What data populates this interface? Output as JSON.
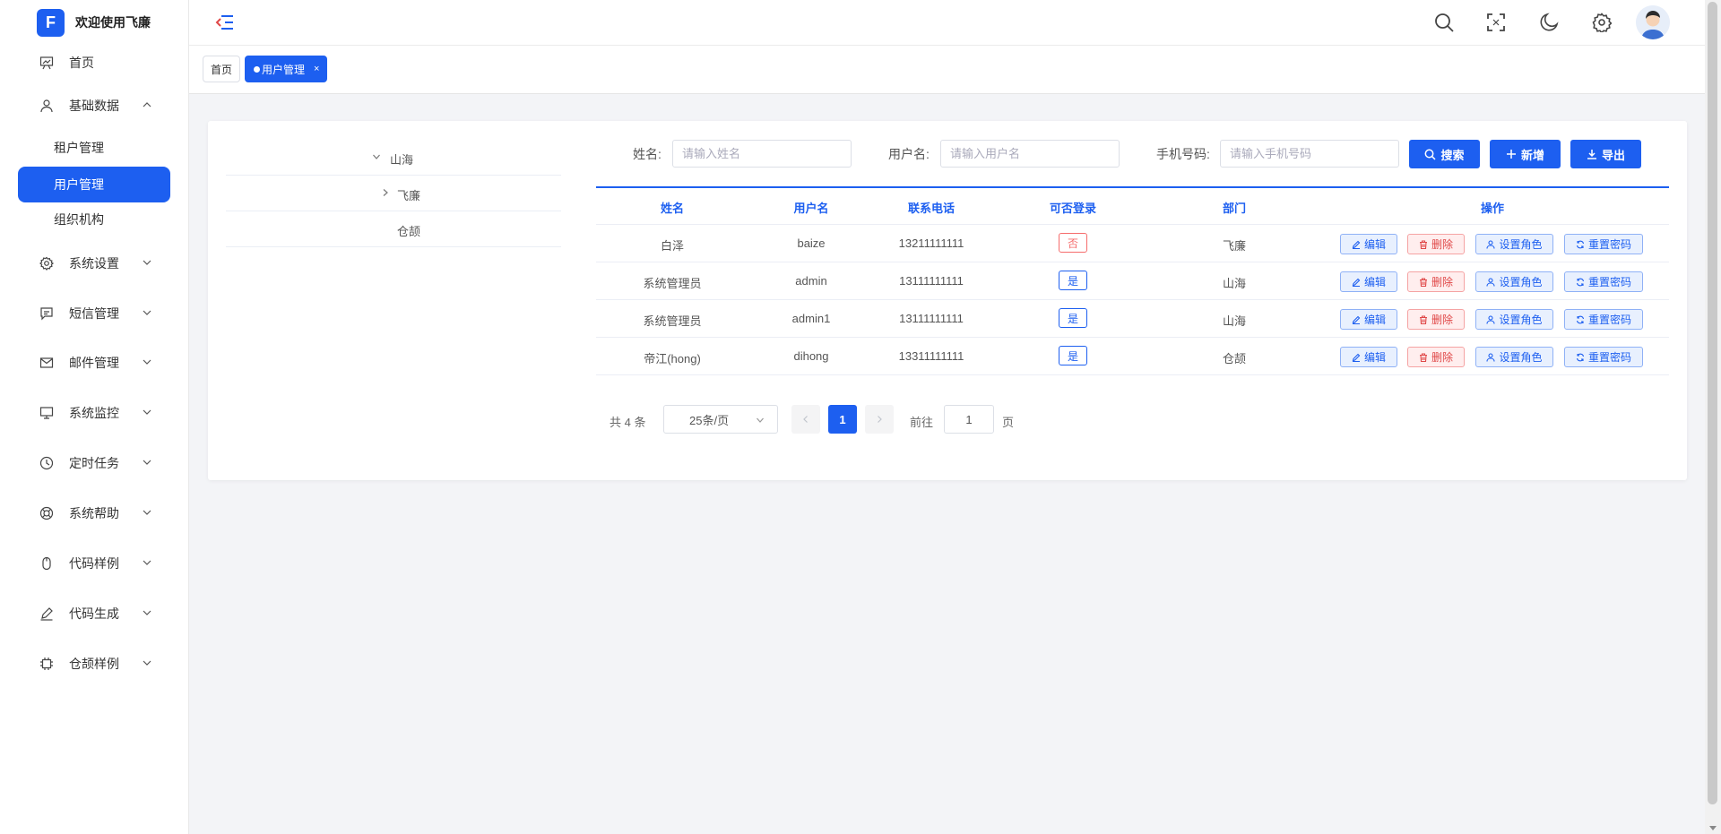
{
  "brand": {
    "logo_letter": "F",
    "title": "欢迎使用飞廉"
  },
  "sidebar": {
    "items": [
      {
        "label": "首页",
        "icon": "presentation-icon"
      },
      {
        "label": "基础数据",
        "icon": "user-icon",
        "expanded": true
      },
      {
        "label": "系统设置",
        "icon": "gear-icon"
      },
      {
        "label": "短信管理",
        "icon": "message-icon"
      },
      {
        "label": "邮件管理",
        "icon": "mail-icon"
      },
      {
        "label": "系统监控",
        "icon": "monitor-icon"
      },
      {
        "label": "定时任务",
        "icon": "clock-icon"
      },
      {
        "label": "系统帮助",
        "icon": "lifebuoy-icon"
      },
      {
        "label": "代码样例",
        "icon": "mouse-icon"
      },
      {
        "label": "代码生成",
        "icon": "pen-icon"
      },
      {
        "label": "仓颉样例",
        "icon": "chip-icon"
      }
    ],
    "subitems": [
      {
        "label": "租户管理"
      },
      {
        "label": "用户管理",
        "active": true
      },
      {
        "label": "组织机构"
      }
    ]
  },
  "tabs": [
    {
      "label": "首页"
    },
    {
      "label": "用户管理",
      "active": true,
      "close": "×"
    }
  ],
  "tree": [
    {
      "label": "山海",
      "caret": "down"
    },
    {
      "label": "飞廉",
      "caret": "right"
    },
    {
      "label": "仓颉"
    }
  ],
  "search": {
    "name_label": "姓名:",
    "name_placeholder": "请输入姓名",
    "username_label": "用户名:",
    "username_placeholder": "请输入用户名",
    "phone_label": "手机号码:",
    "phone_placeholder": "请输入手机号码",
    "search_btn": "搜索",
    "add_btn": "新增",
    "export_btn": "导出"
  },
  "table": {
    "headers": [
      "姓名",
      "用户名",
      "联系电话",
      "可否登录",
      "部门",
      "操作"
    ],
    "rows": [
      {
        "name": "白泽",
        "username": "baize",
        "phone": "13211111111",
        "login": "否",
        "dept": "飞廉"
      },
      {
        "name": "系统管理员",
        "username": "admin",
        "phone": "13111111111",
        "login": "是",
        "dept": "山海"
      },
      {
        "name": "系统管理员",
        "username": "admin1",
        "phone": "13111111111",
        "login": "是",
        "dept": "山海"
      },
      {
        "name": "帝江(hong)",
        "username": "dihong",
        "phone": "13311111111",
        "login": "是",
        "dept": "仓颉"
      }
    ],
    "actions": {
      "edit": "编辑",
      "delete": "删除",
      "role": "设置角色",
      "reset": "重置密码"
    }
  },
  "pagination": {
    "total_text": "共 4 条",
    "page_size": "25条/页",
    "current_page": "1",
    "goto_label": "前往",
    "goto_value": "1",
    "page_suffix": "页"
  },
  "colors": {
    "primary": "#1d5ff0",
    "danger": "#f56c6c"
  }
}
